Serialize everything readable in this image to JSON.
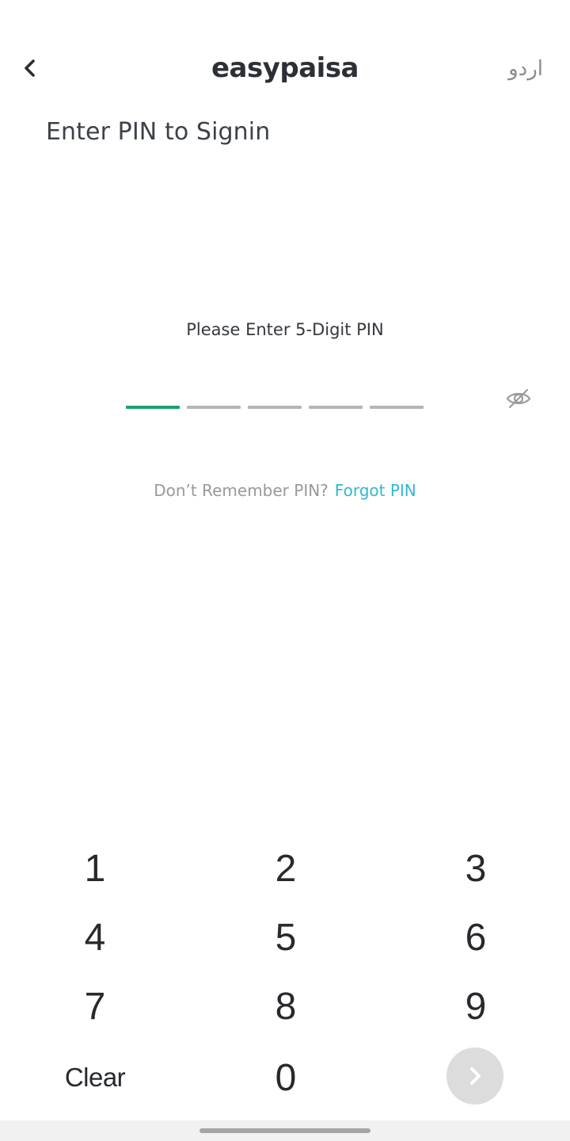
{
  "header": {
    "back_icon": "chevron-left-icon",
    "logo_text": "easypaisa",
    "language_label": "اردو"
  },
  "page_title": "Enter PIN to Signin",
  "pin": {
    "instruction": "Please Enter 5-Digit PIN",
    "length": 5,
    "entered_digits": 0,
    "active_color": "#1aa36b",
    "inactive_color": "#b3b5b8",
    "visibility_icon": "eye-off-icon"
  },
  "forgot": {
    "prompt": "Don’t Remember PIN?",
    "link_label": "Forgot PIN",
    "link_color": "#2fb7d4"
  },
  "keypad": {
    "keys": [
      "1",
      "2",
      "3",
      "4",
      "5",
      "6",
      "7",
      "8",
      "9"
    ],
    "clear_label": "Clear",
    "zero_label": "0",
    "submit_icon": "chevron-right-icon"
  }
}
